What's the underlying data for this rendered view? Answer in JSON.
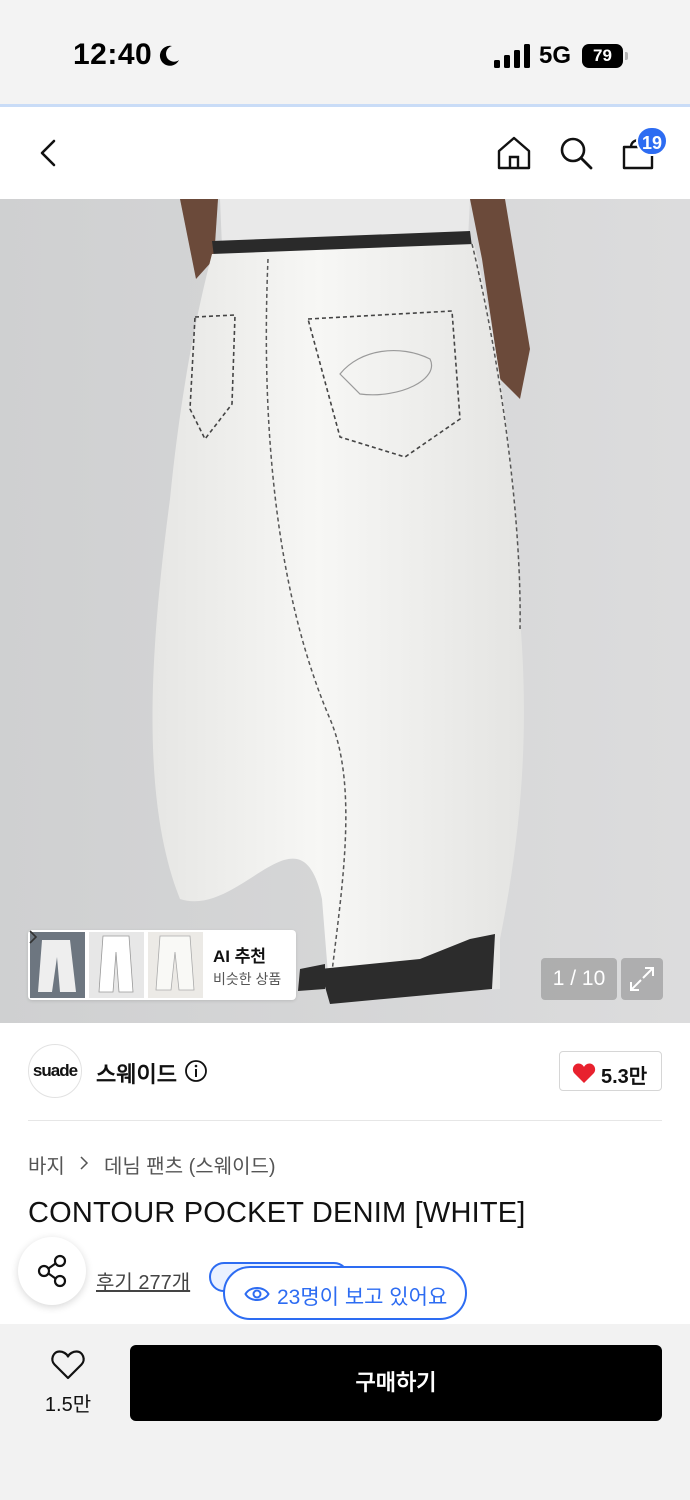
{
  "status_bar": {
    "time": "12:40",
    "network": "5G",
    "battery": "79"
  },
  "header": {
    "icons": [
      "back-icon",
      "home-icon",
      "search-icon",
      "shopping-bag-icon"
    ],
    "cart_count": "19"
  },
  "gallery": {
    "counter": "1 / 10",
    "ai_card": {
      "title": "AI 추천",
      "subtitle": "비슷한 상품"
    }
  },
  "brand": {
    "logo_text": "suade",
    "name": "스웨이드",
    "likes": "5.3만"
  },
  "breadcrumb": [
    "바지",
    "데님 팬츠 (스웨이드)"
  ],
  "product": {
    "title": "CONTOUR POCKET DENIM [WHITE]",
    "review_link": "후기 277개",
    "viewers": "23명이 보고 있어요"
  },
  "bottom_bar": {
    "wish_count": "1.5만",
    "buy_label": "구매하기"
  },
  "colors": {
    "accent": "#2d6cf2",
    "heart": "#e8212e",
    "buy_button": "#000000"
  }
}
